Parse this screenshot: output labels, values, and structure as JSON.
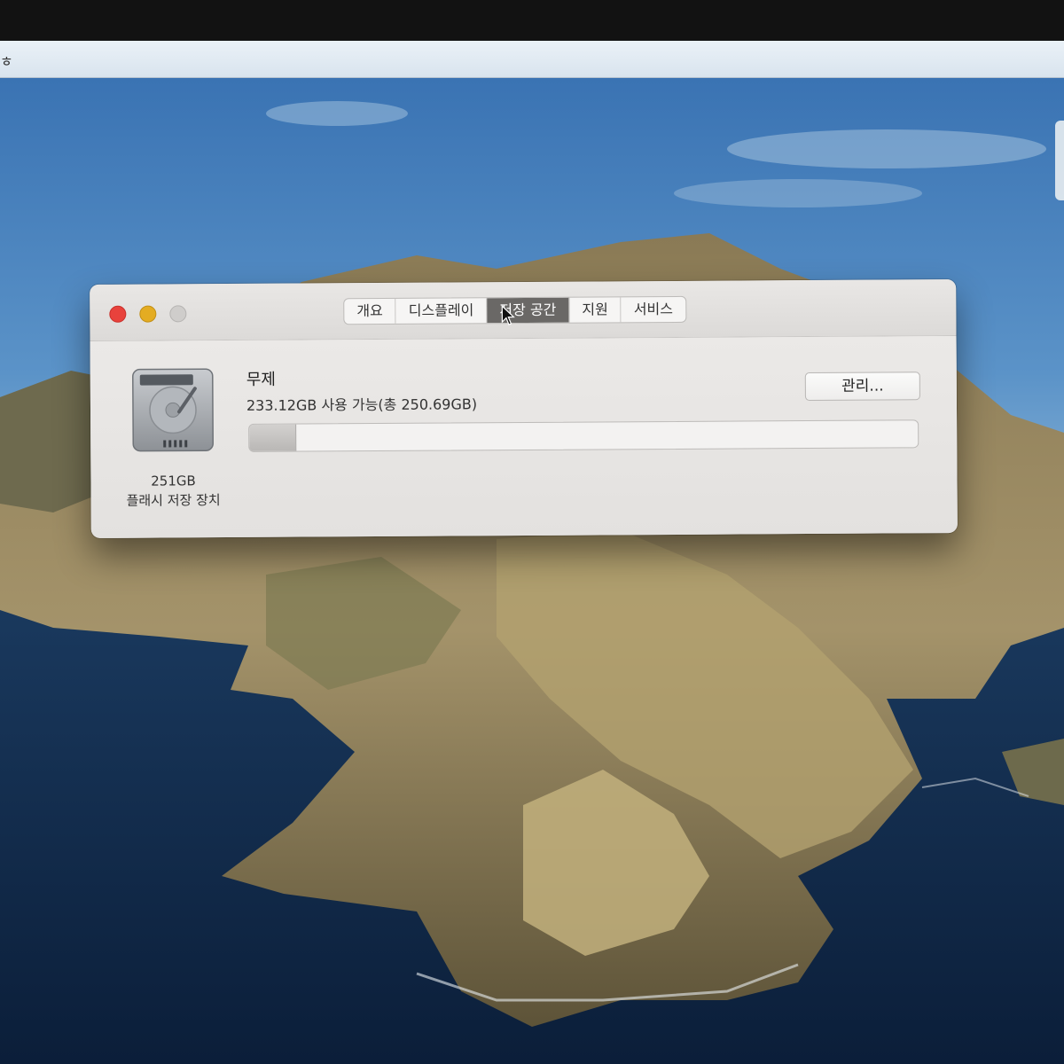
{
  "menubar": {
    "glyph": "ㅎ"
  },
  "window": {
    "tabs": [
      {
        "label": "개요",
        "active": false
      },
      {
        "label": "디스플레이",
        "active": false
      },
      {
        "label": "저장 공간",
        "active": true
      },
      {
        "label": "지원",
        "active": false
      },
      {
        "label": "서비스",
        "active": false
      }
    ],
    "disk": {
      "icon": "hard-drive-icon",
      "size": "251GB",
      "type": "플래시 저장 장치"
    },
    "volume": {
      "name": "무제",
      "availability": "233.12GB 사용 가능(총 250.69GB)",
      "used_fraction": 0.07
    },
    "manage_button": "관리..."
  },
  "colors": {
    "close": "#e8423c",
    "minimize": "#e4ac22",
    "zoom_inactive": "#cfcdcb",
    "active_tab": "#6a6866"
  }
}
